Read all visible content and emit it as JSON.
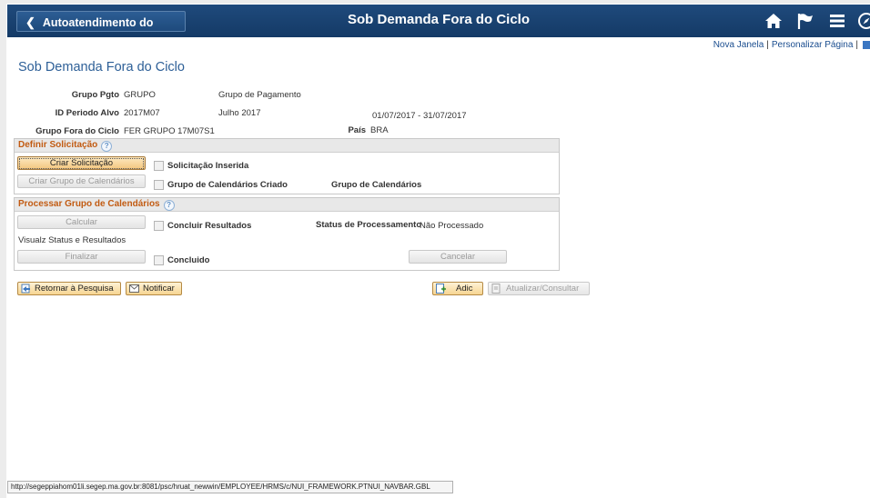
{
  "banner": {
    "back_label": "Autoatendimento do Gerente",
    "title": "Sob Demanda Fora do Ciclo",
    "icons": [
      "home-icon",
      "flag-icon",
      "menu-icon",
      "compass-icon"
    ]
  },
  "toplinks": {
    "new_window": "Nova Janela",
    "personalize": "Personalizar Página",
    "sep": "|"
  },
  "page_title": "Sob Demanda Fora do Ciclo",
  "fields": {
    "grupo_pgto_label": "Grupo Pgto",
    "grupo_pgto_value": "GRUPO",
    "grupo_pgto_desc": "Grupo de Pagamento",
    "periodo_label": "ID Periodo Alvo",
    "periodo_value": "2017M07",
    "periodo_desc": "Julho 2017",
    "periodo_range": "01/07/2017 -  31/07/2017",
    "ciclo_label": "Grupo Fora do Ciclo",
    "ciclo_value": "FER GRUPO 17M07S1",
    "pais_label": "País",
    "pais_value": "BRA"
  },
  "definir": {
    "header": "Definir Solicitação",
    "criar_solicitacao": "Criar Solicitação",
    "solicitacao_inserida": "Solicitação Inserida",
    "criar_grupo": "Criar Grupo de Calendários",
    "grupo_criado": "Grupo de Calendários Criado",
    "grupo_calendarios": "Grupo de Calendários"
  },
  "processar": {
    "header": "Processar Grupo de Calendários",
    "calcular": "Calcular",
    "concluir_resultados": "Concluir Resultados",
    "status_label": "Status de Processamento",
    "status_value": "Não Processado",
    "visualz": "Visualz Status e Resultados",
    "finalizar": "Finalizar",
    "concluido": "Concluido",
    "cancelar": "Cancelar"
  },
  "toolbar": {
    "retornar": "Retornar à Pesquisa",
    "notificar": "Notificar",
    "adic": "Adic",
    "atualizar": "Atualizar/Consultar"
  },
  "statusbar": "http://segeppiahom01li.segep.ma.gov.br:8081/psc/hruat_newwin/EMPLOYEE/HRMS/c/NUI_FRAMEWORK.PTNUI_NAVBAR.GBL",
  "colors": {
    "banner": "#1f4a7c",
    "section_header_text": "#c25b12",
    "title": "#2d5f97"
  }
}
